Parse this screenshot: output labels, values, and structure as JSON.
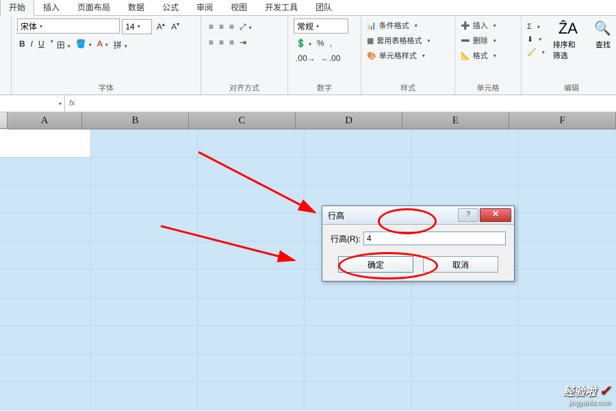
{
  "tabs": {
    "home": "开始",
    "insert": "插入",
    "layout": "页面布局",
    "data": "数据",
    "formula": "公式",
    "review": "审阅",
    "view": "视图",
    "dev": "开发工具",
    "team": "团队"
  },
  "ribbon": {
    "font": {
      "name": "宋体",
      "size": "14",
      "bold": "B",
      "italic": "I",
      "underline": "U",
      "label": "字体"
    },
    "align": {
      "label": "对齐方式"
    },
    "number": {
      "format": "常规",
      "label": "数字"
    },
    "styles": {
      "cond": "条件格式",
      "table": "套用表格格式",
      "cell": "单元格样式",
      "label": "样式"
    },
    "cells": {
      "insert": "插入",
      "delete": "删除",
      "format": "格式",
      "label": "单元格"
    },
    "editing": {
      "sort": "排序和筛选",
      "find": "查找",
      "label": "编辑"
    }
  },
  "columns": [
    "A",
    "B",
    "C",
    "D",
    "E",
    "F"
  ],
  "dialog": {
    "title": "行高",
    "field_label": "行高(R):",
    "value": "4",
    "ok": "确定",
    "cancel": "取消"
  },
  "watermark": {
    "main": "经验啦",
    "sub": "jingyanla.com",
    "check": "✓"
  }
}
